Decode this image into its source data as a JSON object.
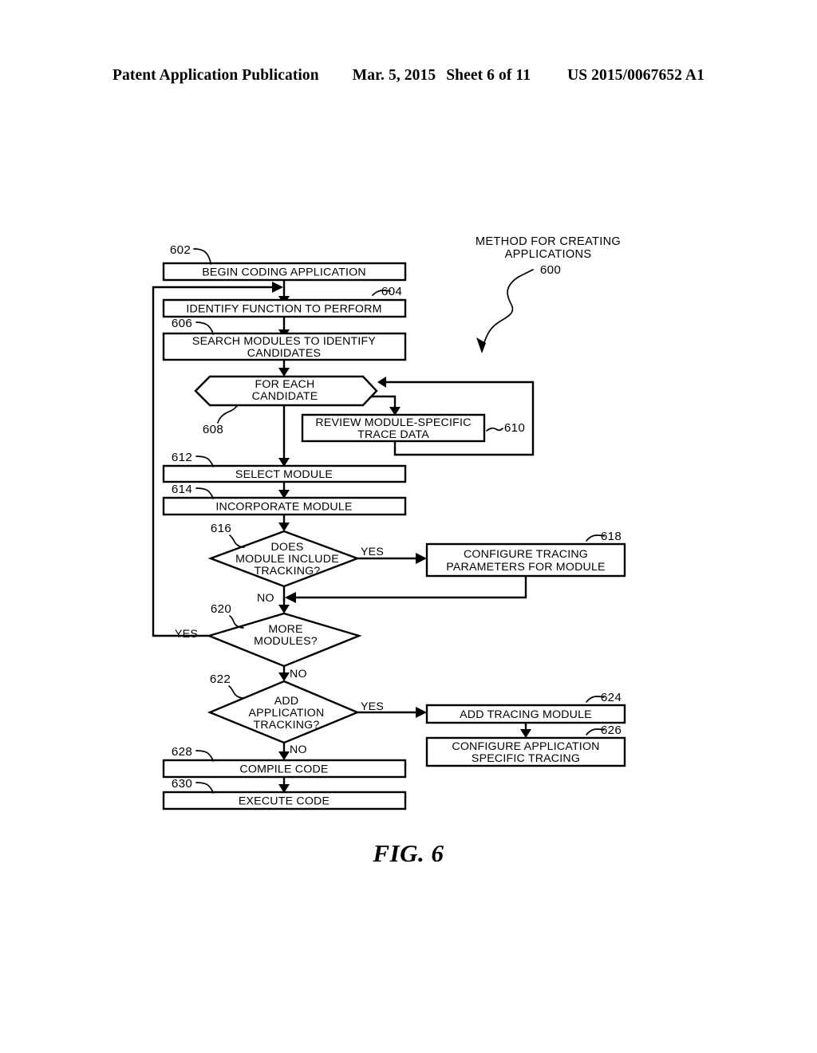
{
  "header": {
    "publication": "Patent Application Publication",
    "date": "Mar. 5, 2015",
    "sheet": "Sheet 6 of 11",
    "patent_number": "US 2015/0067652 A1"
  },
  "figure": {
    "caption": "FIG. 6",
    "annotation_title_line1": "METHOD FOR CREATING",
    "annotation_title_line2": "APPLICATIONS",
    "annotation_ref": "600"
  },
  "nodes": {
    "n602": {
      "ref": "602",
      "line1": "BEGIN CODING APPLICATION",
      "line2": "",
      "shape": "process"
    },
    "n604": {
      "ref": "604",
      "line1": "IDENTIFY FUNCTION TO PERFORM",
      "line2": "",
      "shape": "process"
    },
    "n606": {
      "ref": "606",
      "line1": "SEARCH MODULES TO IDENTIFY",
      "line2": "CANDIDATES",
      "shape": "process"
    },
    "n608": {
      "ref": "608",
      "line1": "FOR EACH",
      "line2": "CANDIDATE",
      "shape": "loop"
    },
    "n610": {
      "ref": "610",
      "line1": "REVIEW MODULE-SPECIFIC",
      "line2": "TRACE DATA",
      "shape": "process"
    },
    "n612": {
      "ref": "612",
      "line1": "SELECT MODULE",
      "line2": "",
      "shape": "process"
    },
    "n614": {
      "ref": "614",
      "line1": "INCORPORATE MODULE",
      "line2": "",
      "shape": "process"
    },
    "n616": {
      "ref": "616",
      "line1": "DOES",
      "line2": "MODULE INCLUDE",
      "line3": "TRACKING?",
      "shape": "decision"
    },
    "n618": {
      "ref": "618",
      "line1": "CONFIGURE TRACING",
      "line2": "PARAMETERS FOR MODULE",
      "shape": "process"
    },
    "n620": {
      "ref": "620",
      "line1": "MORE",
      "line2": "MODULES?",
      "shape": "decision"
    },
    "n622": {
      "ref": "622",
      "line1": "ADD",
      "line2": "APPLICATION",
      "line3": "TRACKING?",
      "shape": "decision"
    },
    "n624": {
      "ref": "624",
      "line1": "ADD TRACING MODULE",
      "line2": "",
      "shape": "process"
    },
    "n626": {
      "ref": "626",
      "line1": "CONFIGURE APPLICATION",
      "line2": "SPECIFIC TRACING",
      "shape": "process"
    },
    "n628": {
      "ref": "628",
      "line1": "COMPILE CODE",
      "line2": "",
      "shape": "process"
    },
    "n630": {
      "ref": "630",
      "line1": "EXECUTE CODE",
      "line2": "",
      "shape": "process"
    }
  },
  "branch_labels": {
    "yes_616": "YES",
    "no_616": "NO",
    "yes_620": "YES",
    "no_620": "NO",
    "yes_622": "YES",
    "no_622": "NO"
  },
  "colors": {
    "ink": "#000000",
    "paper": "#ffffff"
  }
}
